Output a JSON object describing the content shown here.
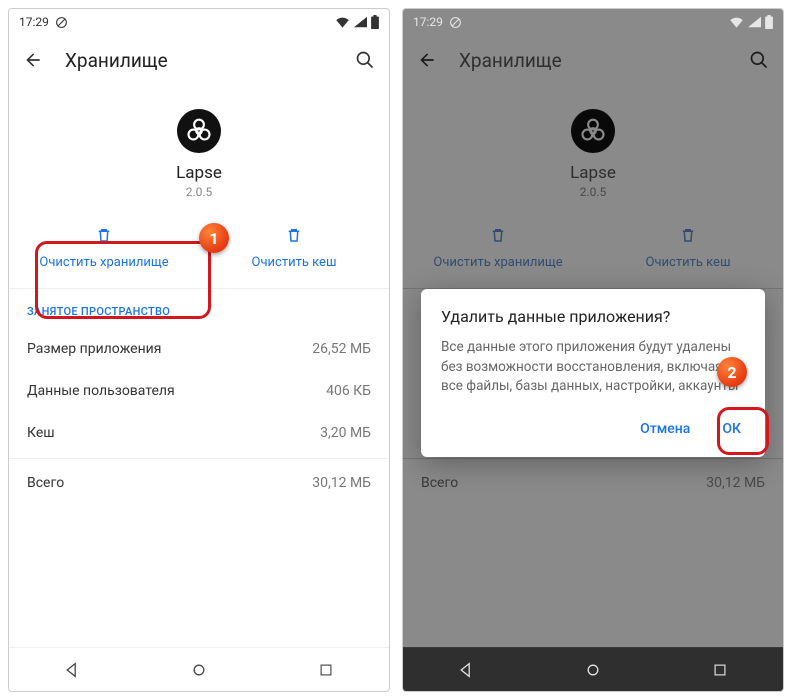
{
  "status": {
    "time": "17:29",
    "icons": [
      "no-sim-icon",
      "wifi-icon",
      "signal-icon",
      "battery-icon"
    ]
  },
  "header": {
    "title": "Хранилище"
  },
  "app": {
    "name": "Lapse",
    "version": "2.0.5"
  },
  "actions": {
    "clear_storage": "Очистить хранилище",
    "clear_cache": "Очистить кеш"
  },
  "section": {
    "label": "ЗАНЯТОЕ ПРОСТРАНСТВО",
    "rows": [
      {
        "label": "Размер приложения",
        "value": "26,52 МБ"
      },
      {
        "label": "Данные пользователя",
        "value": "406 КБ"
      },
      {
        "label": "Кеш",
        "value": "3,20 МБ"
      }
    ],
    "total": {
      "label": "Всего",
      "value": "30,12 МБ"
    }
  },
  "dialog": {
    "title": "Удалить данные приложения?",
    "body": "Все данные этого приложения будут удалены без возможности восстановления, включая все файлы, базы данных, настройки, аккаунты",
    "cancel": "Отмена",
    "ok": "ОК"
  },
  "annotations": {
    "badge1": "1",
    "badge2": "2"
  }
}
